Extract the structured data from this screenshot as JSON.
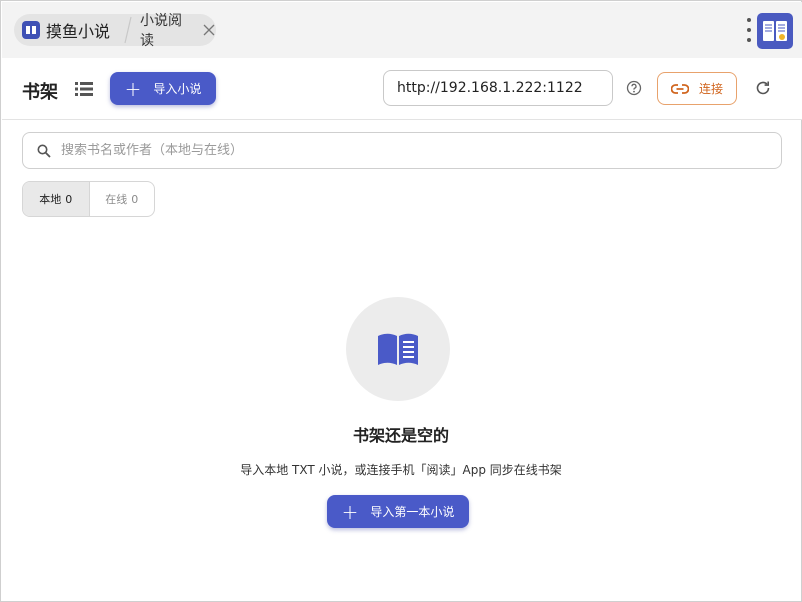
{
  "titlebar": {
    "app_name": "摸鱼小说",
    "tab_label": "小说阅读"
  },
  "toolbar": {
    "title": "书架",
    "import_label": "导入小说",
    "url_value": "http://192.168.1.222:1122",
    "connect_label": "连接"
  },
  "search": {
    "placeholder": "搜索书名或作者（本地与在线）"
  },
  "filters": [
    {
      "label": "本地",
      "count": "0",
      "active": true
    },
    {
      "label": "在线",
      "count": "0",
      "active": false
    }
  ],
  "empty_state": {
    "title": "书架还是空的",
    "description": "导入本地 TXT 小说，或连接手机「阅读」App 同步在线书架",
    "button_label": "导入第一本小说"
  },
  "colors": {
    "primary": "#4a5ac8",
    "connect_accent": "#d0651e"
  },
  "icons": [
    "book-icon",
    "close-icon",
    "more-icon",
    "list-icon",
    "plus-icon",
    "help-icon",
    "link-icon",
    "refresh-icon",
    "search-icon",
    "book-open-icon"
  ]
}
